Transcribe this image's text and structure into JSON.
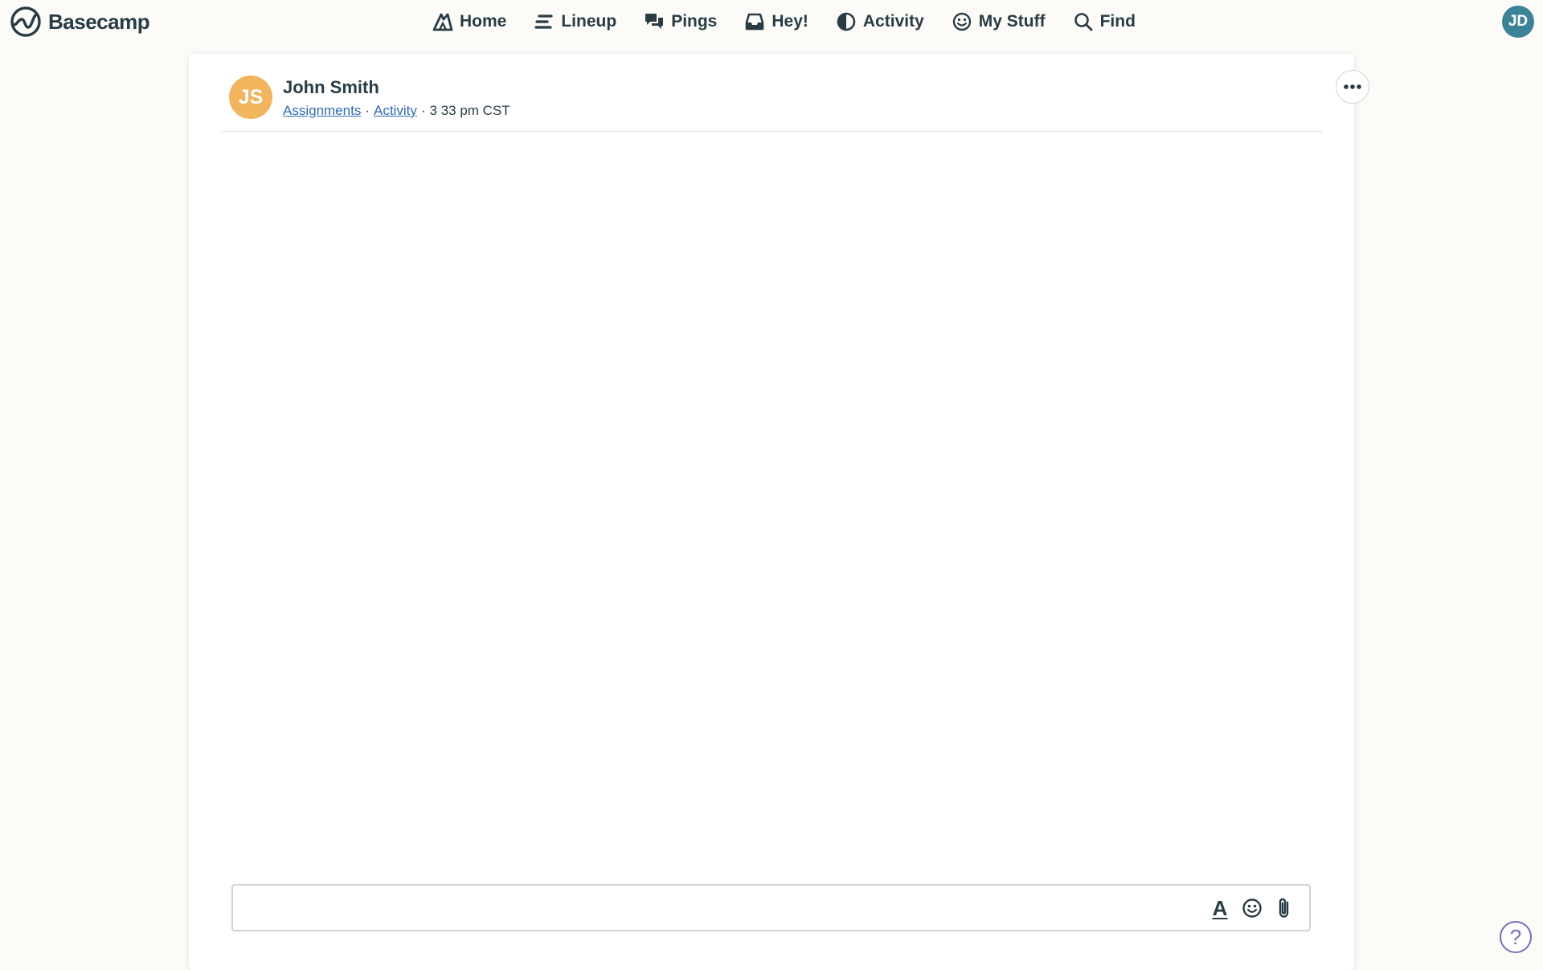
{
  "app": {
    "logo_text": "Basecamp"
  },
  "nav": {
    "items": [
      {
        "label": "Home",
        "icon": "home-icon"
      },
      {
        "label": "Lineup",
        "icon": "lineup-icon"
      },
      {
        "label": "Pings",
        "icon": "pings-icon"
      },
      {
        "label": "Hey!",
        "icon": "hey-inbox-icon"
      },
      {
        "label": "Activity",
        "icon": "activity-icon"
      },
      {
        "label": "My Stuff",
        "icon": "smiley-icon"
      },
      {
        "label": "Find",
        "icon": "search-icon"
      }
    ]
  },
  "current_user": {
    "initials": "JD",
    "avatar_color": "#3b8397"
  },
  "profile": {
    "initials": "JS",
    "avatar_color": "#f2b45c",
    "name": "John Smith",
    "links": {
      "assignments": "Assignments",
      "activity": "Activity"
    },
    "separator": "·",
    "local_time": "3  33 pm CST"
  },
  "composer": {
    "value": "",
    "placeholder": "",
    "tools": {
      "format_label": "A",
      "emoji_icon": "emoji-icon",
      "attach_icon": "paperclip-icon"
    }
  },
  "help": {
    "label": "?"
  },
  "colors": {
    "text": "#283c46",
    "link": "#2e6bb8",
    "background": "#fcfbf8",
    "help_accent": "#7a6bbf"
  }
}
